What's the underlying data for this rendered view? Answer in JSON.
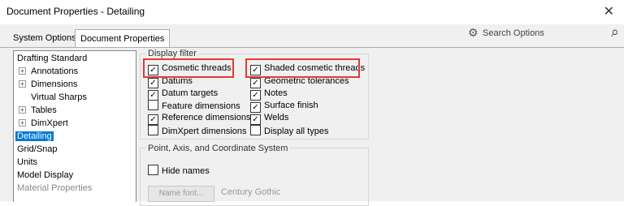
{
  "window": {
    "title": "Document Properties - Detailing"
  },
  "tabs": [
    "System Options",
    "Document Properties"
  ],
  "search": {
    "placeholder": "Search Options"
  },
  "tree": [
    {
      "label": "Drafting Standard"
    },
    {
      "label": "Annotations",
      "expand": "+"
    },
    {
      "label": "Dimensions",
      "expand": "+"
    },
    {
      "label": "Virtual Sharps"
    },
    {
      "label": "Tables",
      "expand": "+"
    },
    {
      "label": "DimXpert",
      "expand": "+"
    },
    {
      "label": "Detailing"
    },
    {
      "label": "Grid/Snap"
    },
    {
      "label": "Units"
    },
    {
      "label": "Model Display"
    },
    {
      "label": "Material Properties"
    }
  ],
  "display_filter": {
    "title": "Display filter",
    "left": [
      {
        "label": "Cosmetic threads",
        "checked": true
      },
      {
        "label": "Datums",
        "checked": true
      },
      {
        "label": "Datum targets",
        "checked": true
      },
      {
        "label": "Feature dimensions",
        "checked": false
      },
      {
        "label": "Reference dimensions",
        "checked": true
      },
      {
        "label": "DimXpert dimensions",
        "checked": false
      }
    ],
    "right": [
      {
        "label": "Shaded cosmetic threads",
        "checked": true
      },
      {
        "label": "Geometric tolerances",
        "checked": true
      },
      {
        "label": "Notes",
        "checked": true
      },
      {
        "label": "Surface finish",
        "checked": true
      },
      {
        "label": "Welds",
        "checked": true
      },
      {
        "label": "Display all types",
        "checked": false
      }
    ]
  },
  "point_axis": {
    "title": "Point, Axis, and Coordinate System",
    "hide_names": {
      "label": "Hide names",
      "checked": false
    },
    "font_button": "Name font...",
    "font_name": "Century Gothic"
  },
  "colors": {
    "selection": "#0078d7",
    "highlight": "#e53935"
  }
}
